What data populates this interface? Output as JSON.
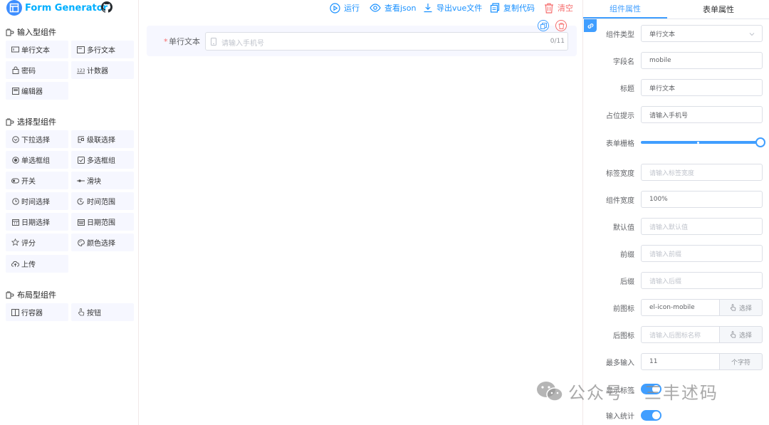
{
  "app": {
    "title": "Form Generator"
  },
  "left": {
    "groups": [
      {
        "title": "输入型组件",
        "items": [
          "单行文本",
          "多行文本",
          "密码",
          "计数器",
          "编辑器"
        ]
      },
      {
        "title": "选择型组件",
        "items": [
          "下拉选择",
          "级联选择",
          "单选框组",
          "多选框组",
          "开关",
          "滑块",
          "时间选择",
          "时间范围",
          "日期选择",
          "日期范围",
          "评分",
          "颜色选择",
          "上传"
        ]
      },
      {
        "title": "布局型组件",
        "items": [
          "行容器",
          "按钮"
        ]
      }
    ]
  },
  "toolbar": {
    "run": "运行",
    "view_json": "查看json",
    "export_vue": "导出vue文件",
    "copy_code": "复制代码",
    "clear": "清空"
  },
  "canvas": {
    "item": {
      "required_mark": "*",
      "label": "单行文本",
      "placeholder": "请输入手机号",
      "counter": "0/11"
    }
  },
  "right": {
    "tabs": [
      "组件属性",
      "表单属性"
    ],
    "fields": {
      "type": {
        "label": "组件类型",
        "value": "单行文本"
      },
      "field": {
        "label": "字段名",
        "value": "mobile"
      },
      "title": {
        "label": "标题",
        "value": "单行文本"
      },
      "placeholder": {
        "label": "占位提示",
        "value": "请输入手机号"
      },
      "grid": {
        "label": "表单栅格",
        "value": 24,
        "max": 24
      },
      "label_width": {
        "label": "标签宽度",
        "placeholder": "请输入标签宽度"
      },
      "comp_width": {
        "label": "组件宽度",
        "value": "100%"
      },
      "default": {
        "label": "默认值",
        "placeholder": "请输入默认值"
      },
      "prefix": {
        "label": "前缀",
        "placeholder": "请输入前缀"
      },
      "suffix": {
        "label": "后缀",
        "placeholder": "请输入后缀"
      },
      "prefix_icon": {
        "label": "前图标",
        "value": "el-icon-mobile",
        "button": "选择"
      },
      "suffix_icon": {
        "label": "后图标",
        "placeholder": "请输入后图标名称",
        "button": "选择"
      },
      "maxlength": {
        "label": "最多输入",
        "value": "11",
        "append": "个字符"
      },
      "show_label": {
        "label": "显示标签",
        "on": true
      },
      "show_count": {
        "label": "输入统计",
        "on": true
      }
    }
  },
  "watermark": "公众号 · 三丰述码",
  "colors": {
    "primary": "#409eff",
    "danger": "#f56c6c",
    "logo": "#00afff"
  }
}
